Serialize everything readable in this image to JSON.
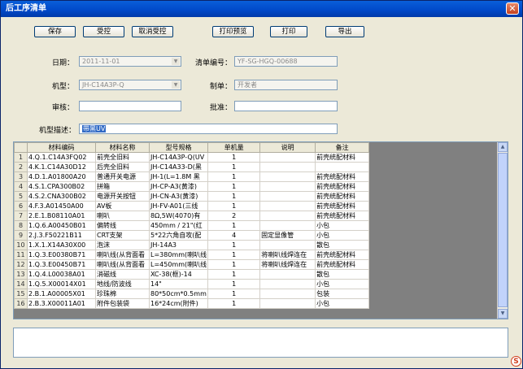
{
  "window": {
    "title": "后工序清单"
  },
  "toolbar": {
    "save": "保存",
    "accept": "受控",
    "cancel_accept": "取消受控",
    "print_preview": "打印预览",
    "print": "打印",
    "export": "导出"
  },
  "form": {
    "date_label": "日期：",
    "date_value": "2011-11-01",
    "list_no_label": "清单编号：",
    "list_no_value": "YF-SG-HGQ-00688",
    "model_label": "机型：",
    "model_value": "JH-C14A3P-Q",
    "maker_label": "制单：",
    "maker_value": "开发者",
    "review_label": "审核：",
    "review_value": "",
    "approve_label": "批准：",
    "approve_value": "",
    "desc_label": "机型描述：",
    "desc_value": "带黑UV"
  },
  "grid": {
    "columns": [
      "材料编码",
      "材料名称",
      "型号规格",
      "单机量",
      "说明",
      "备注"
    ],
    "rows": [
      [
        "1",
        "4.Q.1.C14A3FQ02",
        "前壳全旧料",
        "JH-C14A3P-Q(UV",
        "1",
        "",
        "前壳统配材料"
      ],
      [
        "2",
        "4.K.1.C14A30D12",
        "后壳全旧料",
        "JH-C14A33-D(黑",
        "1",
        "",
        ""
      ],
      [
        "3",
        "4.D.1.A01800A20",
        "普通开关电源",
        "JH-1(L=1.8M 黑",
        "1",
        "",
        "前壳统配材料"
      ],
      [
        "4",
        "4.S.1.CPA300B02",
        "拼箱",
        "JH-CP-A3(黄漆)",
        "1",
        "",
        "前壳统配材料"
      ],
      [
        "5",
        "4.S.2.CNA300B02",
        "电源开关按钮",
        "JH-CN-A3(黄漆)",
        "1",
        "",
        "前壳统配材料"
      ],
      [
        "6",
        "4.F.3.A01450A00",
        "AV板",
        "JH-FV-A01(三线",
        "1",
        "",
        "前壳统配材料"
      ],
      [
        "7",
        "2.E.1.B08110A01",
        "喇叭",
        "8Ω,5W(4070)有",
        "2",
        "",
        "前壳统配材料"
      ],
      [
        "8",
        "1.Q.6.A00450B01",
        "偏转线",
        "450mm / 21\"(红",
        "1",
        "",
        "小包"
      ],
      [
        "9",
        "2.J.3.F50221B11",
        "CRT支架",
        "5*22六角自攻(配",
        "4",
        "固定显像管",
        "小包"
      ],
      [
        "10",
        "1.X.1.X14A30X00",
        "泡沫",
        "JH-14A3",
        "1",
        "",
        "散包"
      ],
      [
        "11",
        "1.Q.3.E00380B71",
        "喇叭线(从背面看",
        "L=380mm(喇叭线",
        "1",
        "将喇叭线焊连在",
        "前壳统配材料"
      ],
      [
        "12",
        "1.Q.3.E00450B71",
        "喇叭线(从背面看",
        "L=450mm(喇叭线",
        "1",
        "将喇叭线焊连在",
        "前壳统配材料"
      ],
      [
        "13",
        "1.Q.4.L00038A01",
        "消磁线",
        "XC-38(框)-14",
        "1",
        "",
        "散包"
      ],
      [
        "14",
        "1.Q.5.X00014X01",
        "地线/防波线",
        "14\"",
        "1",
        "",
        "小包"
      ],
      [
        "15",
        "2.B.1.A00005X01",
        "珍珠棉",
        "80*50cm*0.5mm",
        "1",
        "",
        "包装"
      ],
      [
        "16",
        "2.B.3.X00011A01",
        "附件包装袋",
        "16*24cm(附件)",
        "1",
        "",
        "小包"
      ]
    ]
  }
}
